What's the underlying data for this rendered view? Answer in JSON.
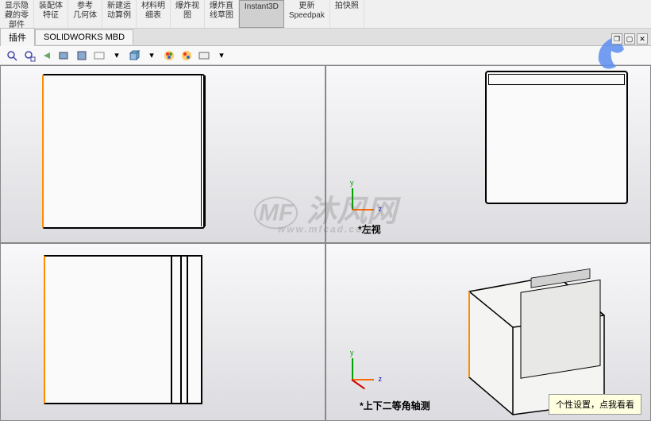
{
  "ribbon": {
    "btn1": "显示隐\n藏的零\n部件",
    "btn2": "装配体\n特征",
    "btn3": "参考\n几何体",
    "btn4": "新建运\n动算例",
    "btn5": "材料明\n细表",
    "btn6": "爆炸视\n图",
    "btn7": "爆炸直\n线草图",
    "btn8": "Instant3D",
    "btn9": "更新\nSpeedpak",
    "btn10": "拍快照"
  },
  "tabs": {
    "t1": "插件",
    "t2": "SOLIDWORKS MBD"
  },
  "viewports": {
    "tl_label": "",
    "tr_label": "*左视",
    "bl_label": "",
    "br_label": "*上下二等角轴测"
  },
  "watermark": {
    "main": "沐风网",
    "sub": "www.mfcad.com"
  },
  "tooltip": "个性设置，点我看看",
  "winctrl": {
    "restore": "❐",
    "max": "▢",
    "close": "✕"
  }
}
